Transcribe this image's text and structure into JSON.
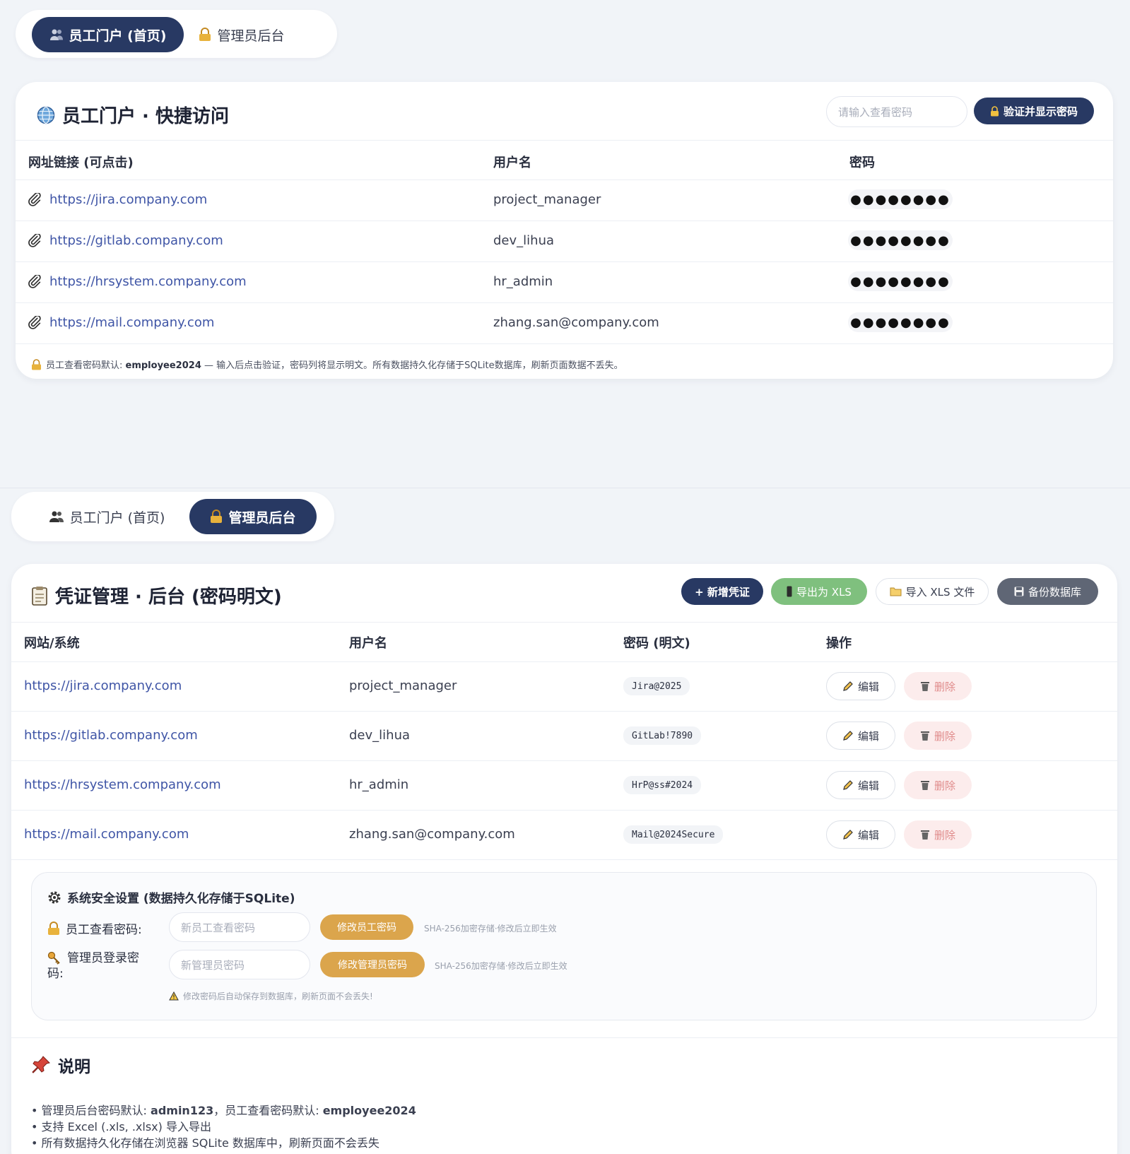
{
  "portal": {
    "tabs": [
      {
        "label": "员工门户 (首页)",
        "icon": "users-icon",
        "active": true
      },
      {
        "label": "管理员后台",
        "icon": "lock-icon",
        "active": false
      }
    ],
    "title": "员工门户 · 快捷访问",
    "search_placeholder": "请输入查看密码",
    "verify_button": "验证并显示密码",
    "columns": [
      "网址链接 (可点击)",
      "用户名",
      "密码"
    ],
    "rows": [
      {
        "url": "https://jira.company.com",
        "username": "project_manager",
        "password": "●●●●●●●●"
      },
      {
        "url": "https://gitlab.company.com",
        "username": "dev_lihua",
        "password": "●●●●●●●●"
      },
      {
        "url": "https://hrsystem.company.com",
        "username": "hr_admin",
        "password": "●●●●●●●●"
      },
      {
        "url": "https://mail.company.com",
        "username": "zhang.san@company.com",
        "password": "●●●●●●●●"
      }
    ],
    "note_prefix": "员工查看密码默认: ",
    "note_bold": "employee2024",
    "note_suffix": " — 输入后点击验证，密码列将显示明文。所有数据持久化存储于SQLite数据库，刷新页面数据不丢失。"
  },
  "admin": {
    "tabs": [
      {
        "label": "员工门户 (首页)",
        "icon": "users-icon",
        "active": false
      },
      {
        "label": "管理员后台",
        "icon": "lock-icon",
        "active": true
      }
    ],
    "title": "凭证管理 · 后台 (密码明文)",
    "buttons": {
      "add": "+ 新增凭证",
      "export": "导出为 XLS",
      "import": "导入 XLS 文件",
      "backup": "备份数据库"
    },
    "columns": [
      "网站/系统",
      "用户名",
      "密码 (明文)",
      "操作"
    ],
    "rows": [
      {
        "url": "https://jira.company.com",
        "username": "project_manager",
        "password": "Jira@2025"
      },
      {
        "url": "https://gitlab.company.com",
        "username": "dev_lihua",
        "password": "GitLab!7890"
      },
      {
        "url": "https://hrsystem.company.com",
        "username": "hr_admin",
        "password": "HrP@ss#2024"
      },
      {
        "url": "https://mail.company.com",
        "username": "zhang.san@company.com",
        "password": "Mail@2024Secure"
      }
    ],
    "edit_label": "编辑",
    "delete_label": "删除",
    "settings": {
      "title": "系统安全设置 (数据持久化存储于SQLite)",
      "employee_label": "员工查看密码:",
      "employee_placeholder": "新员工查看密码",
      "employee_button": "修改员工密码",
      "employee_hint": "SHA-256加密存储·修改后立即生效",
      "admin_label_1": "管理员登录密",
      "admin_label_2": "码:",
      "admin_placeholder": "新管理员密码",
      "admin_button": "修改管理员密码",
      "admin_hint": "SHA-256加密存储·修改后立即生效",
      "warning": "修改密码后自动保存到数据库，刷新页面不会丢失!"
    },
    "info": {
      "title": "说明",
      "line1_prefix": "• 管理员后台密码默认: ",
      "line1_bold1": "admin123",
      "line1_mid": "，员工查看密码默认: ",
      "line1_bold2": "employee2024",
      "line2": "• 支持 Excel (.xls, .xlsx) 导入导出",
      "line3": "• 所有数据持久化存储在浏览器 SQLite 数据库中，刷新页面不会丢失"
    }
  },
  "colors": {
    "navy": "#283963",
    "link": "#3f55a6",
    "green": "#7fc07e",
    "orange": "#dba54c",
    "gray": "#5f6675",
    "delete": "#e08a8a"
  }
}
